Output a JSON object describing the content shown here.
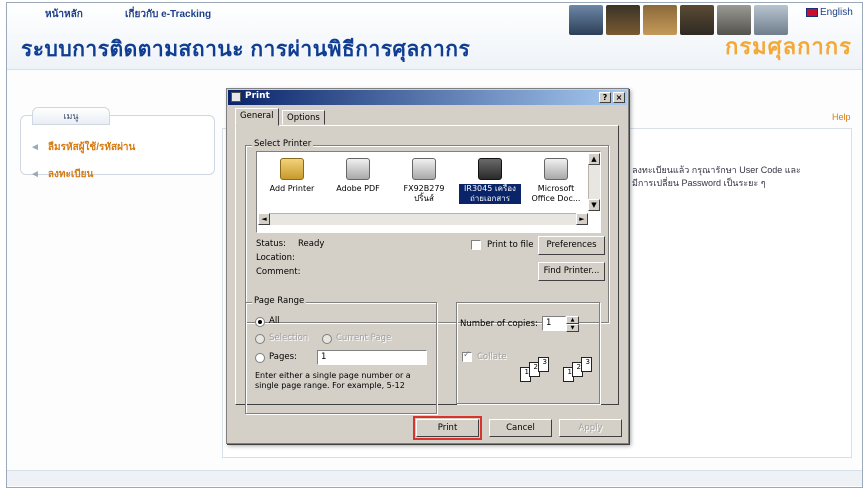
{
  "site": {
    "home_link": "หน้าหลัก",
    "about_link": "เกี่ยวกับ e-Tracking",
    "title": "ระบบการติดตามสถานะ การผ่านพิธีการศุลกากร",
    "brand": "กรมศุลกากร",
    "language_link": "English",
    "menu_title": "เมนู",
    "menu_items": [
      "ลืมรหัสผู้ใช้/รหัสผ่าน",
      "ลงทะเบียน"
    ],
    "help_link": "Help",
    "notice_line1": "ลงทะเบียนแล้ว กรุณารักษา User Code และ",
    "notice_line2": "มีการเปลี่ยน Password เป็นระยะ ๆ"
  },
  "dialog": {
    "title": "Print",
    "help_button": "?",
    "close_button": "×",
    "tabs": [
      "General",
      "Options"
    ],
    "select_printer_label": "Select Printer",
    "printers": [
      {
        "name": "Add Printer",
        "icon": "add-printer-icon"
      },
      {
        "name": "Adobe PDF",
        "icon": "printer-icon"
      },
      {
        "name": "FX92B279 ปริ้นส์",
        "icon": "printer-icon"
      },
      {
        "name": "IR3045 เครื่องถ่ายเอกสาร",
        "icon": "printer-icon",
        "selected": true
      },
      {
        "name": "Microsoft Office Doc...",
        "icon": "printer-icon"
      }
    ],
    "status_label": "Status:",
    "status_value": "Ready",
    "location_label": "Location:",
    "location_value": "",
    "comment_label": "Comment:",
    "comment_value": "",
    "print_to_file_label": "Print to file",
    "preferences_button": "Preferences",
    "find_printer_button": "Find Printer...",
    "page_range_label": "Page Range",
    "range_all_label": "All",
    "range_selection_label": "Selection",
    "range_current_label": "Current Page",
    "range_pages_label": "Pages:",
    "pages_value": "1",
    "range_hint": "Enter either a single page number or a single page range.  For example, 5-12",
    "copies_label": "Number of copies:",
    "copies_value": "1",
    "collate_label": "Collate",
    "collate_pages": [
      "1",
      "2",
      "3"
    ],
    "print_button": "Print",
    "cancel_button": "Cancel",
    "apply_button": "Apply"
  }
}
